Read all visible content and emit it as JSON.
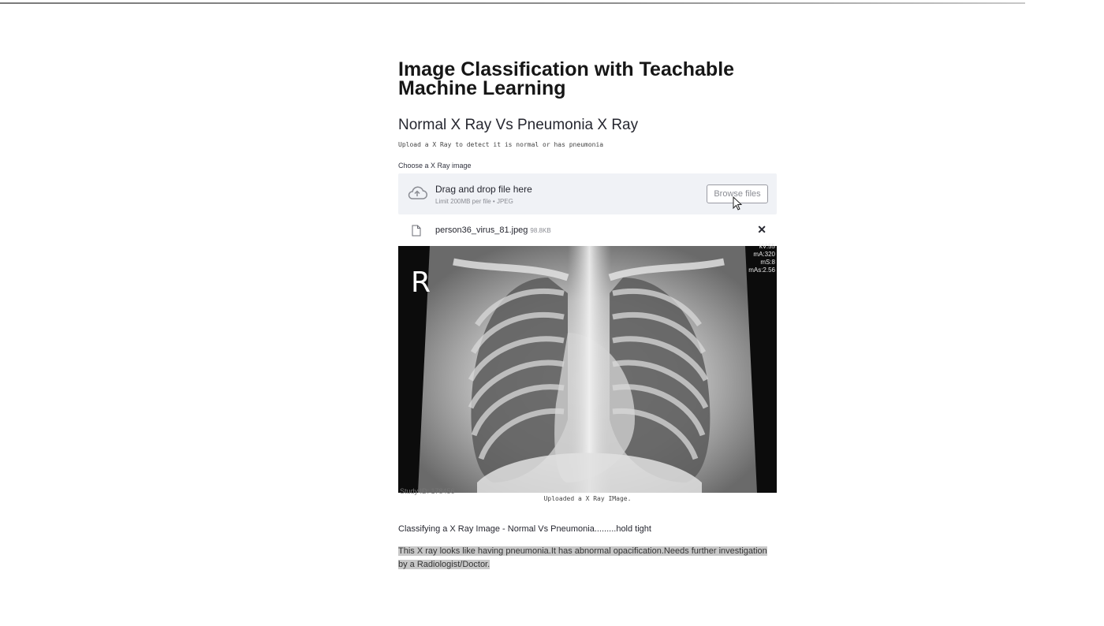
{
  "page": {
    "title": "Image Classification with Teachable Machine Learning",
    "subheader": "Normal X Ray Vs Pneumonia X Ray",
    "description": "Upload a X Ray to detect it is normal or has pneumonia"
  },
  "uploader": {
    "label": "Choose a X Ray image",
    "drop_title": "Drag and drop file here",
    "drop_limit": "Limit 200MB per file • JPEG",
    "browse_label": "Browse files"
  },
  "file": {
    "name": "person36_virus_81.jpeg",
    "size": "98.8KB"
  },
  "image": {
    "marker": "R",
    "settings": [
      "kV:55",
      "mA:320",
      "mS:8",
      "mAs:2.56"
    ],
    "study_id": "Study ID: 178456",
    "caption": "Uploaded a X Ray IMage."
  },
  "status": {
    "classifying": "Classifying a X Ray Image - Normal Vs Pneumonia.........hold tight",
    "result_line1": "This X ray looks like having pneumonia.It has abnormal opacification.Needs further investigation",
    "result_line2": "by a Radiologist/Doctor."
  },
  "icons": {
    "upload": "cloud-upload-icon",
    "file": "file-icon",
    "close": "close-icon",
    "cursor": "mouse-pointer-icon"
  },
  "colors": {
    "dropzone_bg": "#f0f2f6",
    "highlight": "#c8c8c8",
    "text": "#262730"
  }
}
